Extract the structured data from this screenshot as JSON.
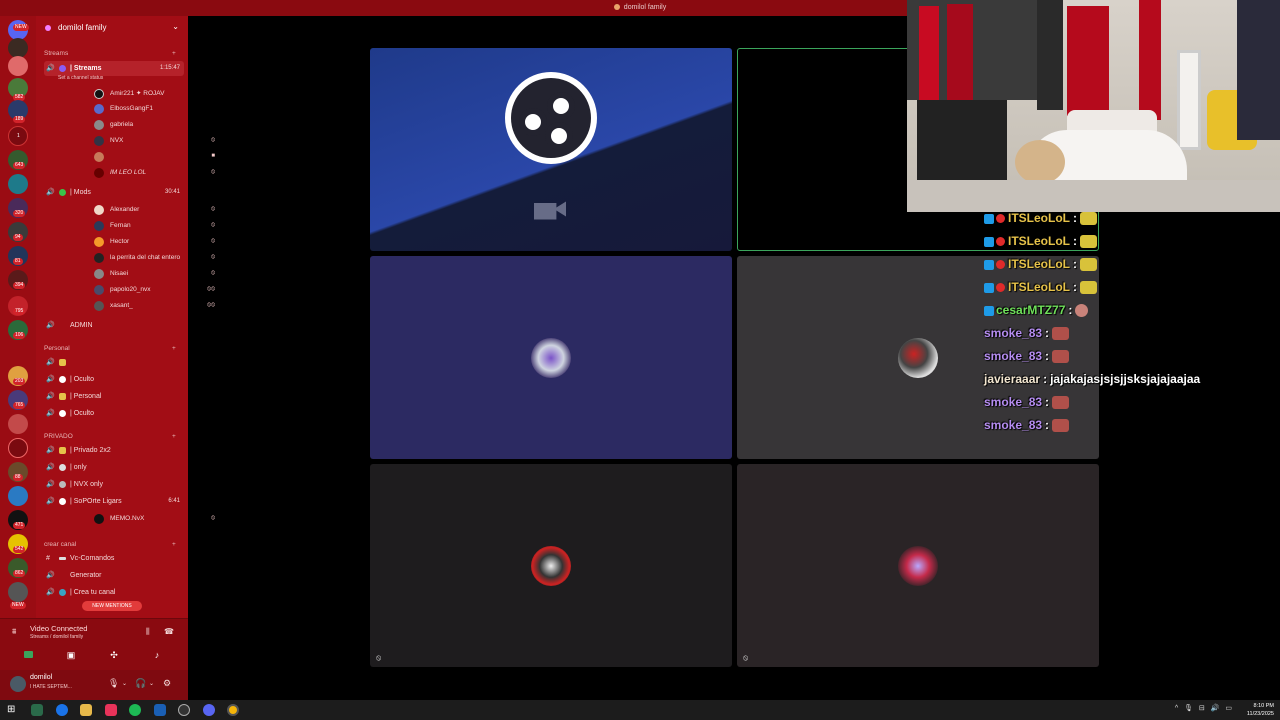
{
  "window": {
    "title": "domilol family"
  },
  "server_rail": {
    "badges": [
      "NEW",
      "582",
      "189",
      "1",
      "643",
      "320",
      "94",
      "81",
      "394",
      "795",
      "106",
      "203",
      "765",
      "88",
      "471",
      "542",
      "862",
      "NEW"
    ]
  },
  "sidebar": {
    "guild_name": "domilol family",
    "categories": {
      "streams": "Streams",
      "personal": "Personal",
      "privado": "PRIVADO",
      "crear_canal": "crear canal"
    },
    "channels": {
      "streams": {
        "label": "| Streams",
        "time": "1:15:47",
        "status": "Set a channel status"
      },
      "mods": {
        "label": "| Mods",
        "time": "30:41"
      },
      "admin": {
        "label": "ADMIN"
      },
      "oculto1": {
        "label": "| Oculto"
      },
      "personal": {
        "label": "| Personal"
      },
      "oculto2": {
        "label": "| Oculto"
      },
      "privado": {
        "label": "| Privado 2x2"
      },
      "only": {
        "label": "| only"
      },
      "nvx_only": {
        "label": "| NVX only"
      },
      "soporte": {
        "label": "| SoPOrte Ligars",
        "time": "6:41"
      },
      "vc_comandos": {
        "label": "Vc-Comandos"
      },
      "generator": {
        "label": "Generator"
      },
      "crea_canal": {
        "label": "| Crea tu canal"
      }
    },
    "streams_users": [
      "Amir221 ✦ ROJAV",
      "ElbossGangF1",
      "gabriela",
      "NVX",
      "",
      "IM LEO LOL"
    ],
    "mods_users": [
      "Alexander",
      "Fernan",
      "Hector",
      "la perrita del chat entero",
      "Nisaei",
      "papolo20_nvx",
      "xasant_"
    ],
    "soporte_users": [
      "MEMO.NvX"
    ],
    "new_mentions": "NEW MENTIONS"
  },
  "voice_panel": {
    "title": "Video Connected",
    "subtitle": "Streams / domilol family"
  },
  "user_panel": {
    "name": "domilol",
    "status": "I HATE SEPTEM..."
  },
  "chat": [
    {
      "user": "ITSLeoLoL",
      "color": "#e6c24a",
      "badges": [
        "sub",
        "mod"
      ],
      "emote_color": "#d8c23a",
      "text": ""
    },
    {
      "user": "ITSLeoLoL",
      "color": "#e6c24a",
      "badges": [
        "sub",
        "mod"
      ],
      "emote_color": "#d8c23a",
      "text": ""
    },
    {
      "user": "ITSLeoLoL",
      "color": "#e6c24a",
      "badges": [
        "sub",
        "mod"
      ],
      "emote_color": "#d8c23a",
      "text": ""
    },
    {
      "user": "ITSLeoLoL",
      "color": "#e6c24a",
      "badges": [
        "sub",
        "mod"
      ],
      "emote_color": "#d8c23a",
      "text": ""
    },
    {
      "user": "cesarMTZ77",
      "color": "#6fe05a",
      "badges": [
        "sub"
      ],
      "emote_color": "#c9837a",
      "text": ""
    },
    {
      "user": "smoke_83",
      "color": "#b58cf0",
      "badges": [],
      "emote_color": "#b0504a",
      "text": ""
    },
    {
      "user": "smoke_83",
      "color": "#b58cf0",
      "badges": [],
      "emote_color": "#b0504a",
      "text": ""
    },
    {
      "user": "javieraaar",
      "color": "#f3e6d0",
      "badges": [],
      "emote_color": "",
      "text": "jajakajasjsjsjjsksjajajaajaa"
    },
    {
      "user": "smoke_83",
      "color": "#b58cf0",
      "badges": [],
      "emote_color": "#b0504a",
      "text": ""
    },
    {
      "user": "smoke_83",
      "color": "#b58cf0",
      "badges": [],
      "emote_color": "#b0504a",
      "text": ""
    }
  ],
  "chat_separator": ":",
  "taskbar": {
    "time": "8:10 PM",
    "date": "11/23/2025"
  }
}
